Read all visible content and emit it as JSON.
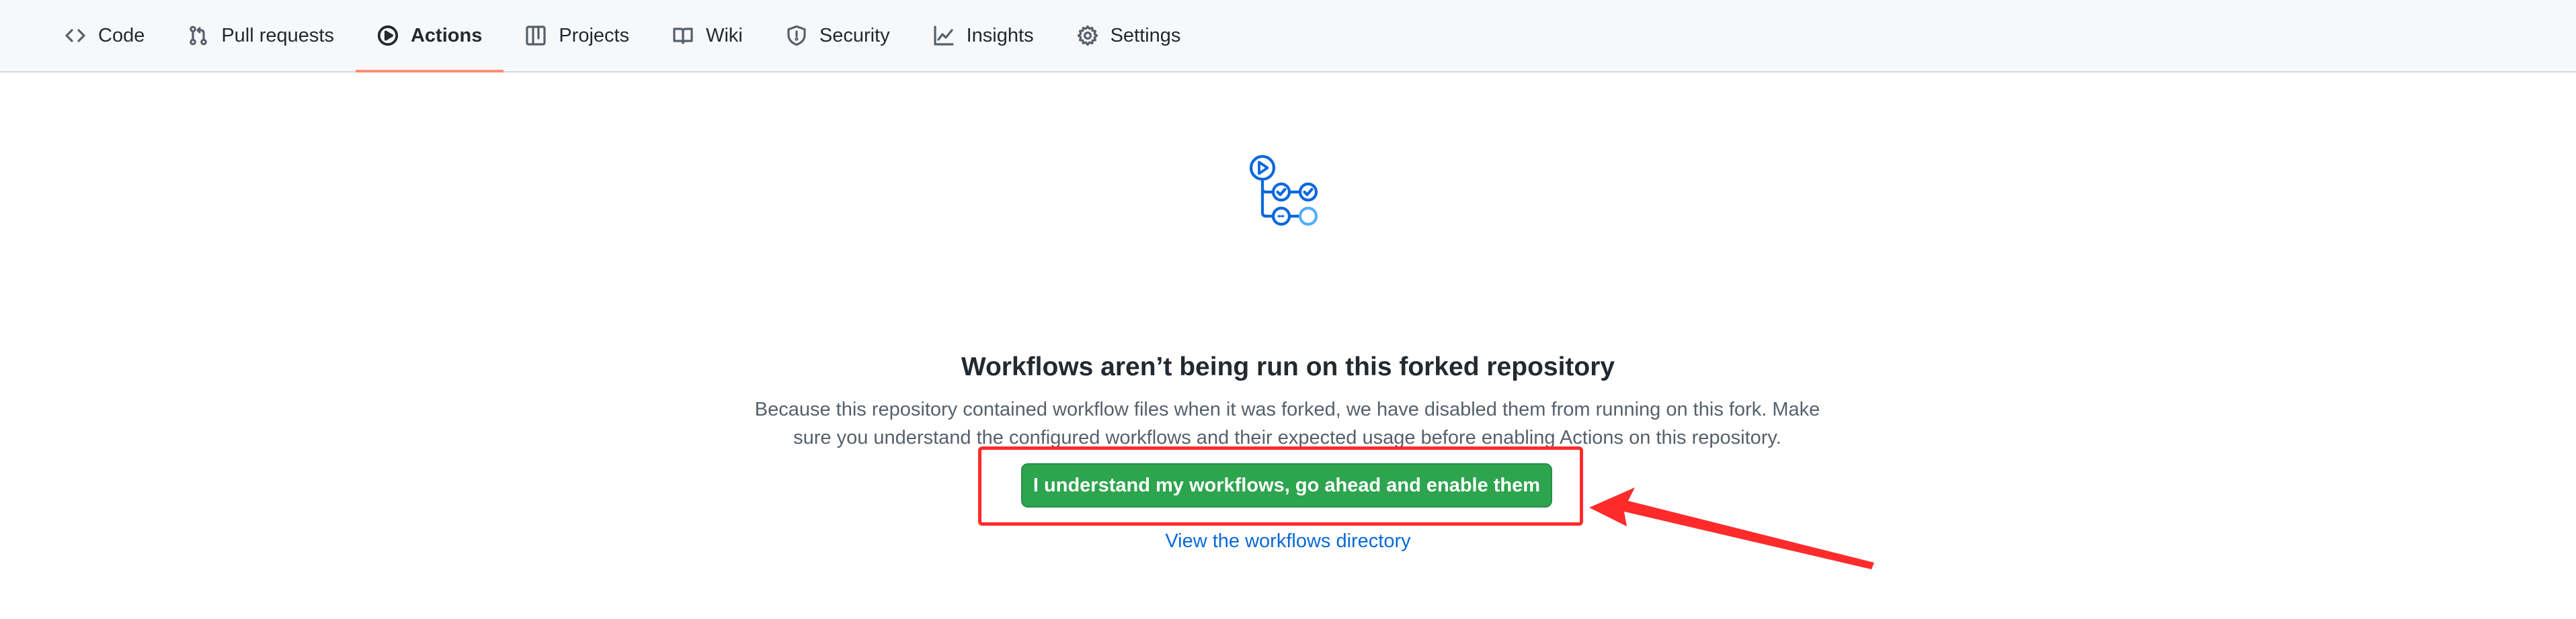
{
  "repo_nav": {
    "tabs": [
      {
        "label": "Code",
        "icon": "code-icon",
        "selected": false
      },
      {
        "label": "Pull requests",
        "icon": "git-pull-request-icon",
        "selected": false
      },
      {
        "label": "Actions",
        "icon": "play-icon",
        "selected": true
      },
      {
        "label": "Projects",
        "icon": "table-icon",
        "selected": false
      },
      {
        "label": "Wiki",
        "icon": "book-icon",
        "selected": false
      },
      {
        "label": "Security",
        "icon": "shield-icon",
        "selected": false
      },
      {
        "label": "Insights",
        "icon": "graph-icon",
        "selected": false
      },
      {
        "label": "Settings",
        "icon": "gear-icon",
        "selected": false
      }
    ],
    "selected_underline_color": "#fd8c73"
  },
  "blankslate": {
    "graphic_icon": "workflow-icon",
    "title": "Workflows aren’t being run on this forked repository",
    "description": "Because this repository contained workflow files when it was forked, we have disabled them from running on this fork. Make sure you understand the configured workflows and their expected usage before enabling Actions on this repository.",
    "enable_button_label": "I understand my workflows, go ahead and enable them",
    "enable_button_color": "#2da44e",
    "workflows_link_label": "View the workflows directory",
    "link_color": "#0969da"
  },
  "annotation": {
    "color": "#ff2b2b",
    "highlight": "red-box-around-enable-button",
    "arrow": "red-arrow-pointing-at-enable-button"
  }
}
